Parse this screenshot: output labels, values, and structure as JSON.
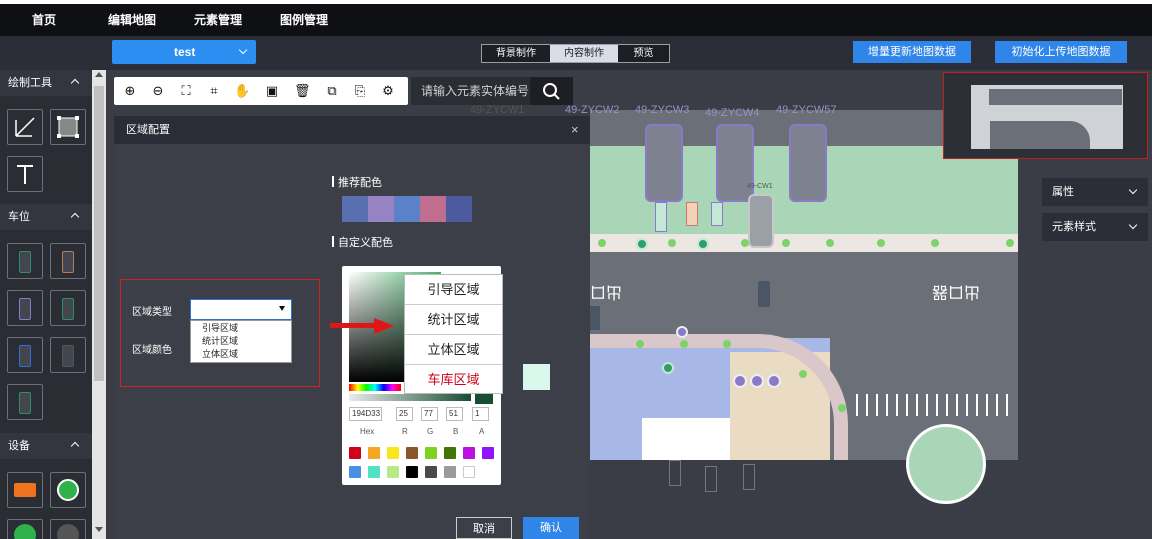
{
  "nav": {
    "items": [
      "首页",
      "编辑地图",
      "元素管理",
      "图例管理"
    ]
  },
  "project": {
    "name": "test"
  },
  "modes": [
    "背景制作",
    "内容制作",
    "预览"
  ],
  "active_mode": "内容制作",
  "top_buttons": [
    "增量更新地图数据",
    "初始化上传地图数据"
  ],
  "left": {
    "sections": [
      {
        "title": "绘制工具"
      },
      {
        "title": "车位"
      },
      {
        "title": "设备"
      }
    ],
    "draw_tools": [
      "line-tool-icon",
      "polygon-tool-icon",
      "text-tool-icon"
    ],
    "slot_colors": [
      "#2c8f6c",
      "#b87b55",
      "#8a7ac8",
      "#2c8f6c",
      "#2f6fd8",
      "#4a5a55",
      "#2c8f6c"
    ]
  },
  "map_toolbar": {
    "icons": [
      "zoom-in-icon",
      "zoom-out-icon",
      "fit-screen-icon",
      "fullscreen-icon",
      "pan-hand-icon",
      "save-icon",
      "delete-icon",
      "copy-icon",
      "paste-icon",
      "settings-icon"
    ],
    "search_placeholder": "请输入元素实体编号"
  },
  "map": {
    "lot_labels": [
      "49-ZYCW1",
      "49-ZYCW2",
      "49-ZYCW3",
      "49-ZYCW4",
      "49-ZYCW57"
    ],
    "lot_label_cw": "49-CW1",
    "road_text_1": "出口",
    "road_text_2": "出口器"
  },
  "right_panels": [
    "属性",
    "元素样式"
  ],
  "dialog": {
    "title": "区域配置",
    "close": "×",
    "recommend_title": "推荐配色",
    "recommend_colors": [
      "#5a6fb0",
      "#9583c4",
      "#5b82c9",
      "#c16d8f",
      "#4c5aa0"
    ],
    "custom_title": "自定义配色",
    "type_label": "区域类型",
    "color_label": "区域颜色",
    "type_options": [
      "引导区域",
      "统计区域",
      "立体区域"
    ],
    "cancel": "取消",
    "confirm": "确认"
  },
  "picker": {
    "hex": "194D33",
    "r": "25",
    "g": "77",
    "b": "51",
    "a": "1",
    "labels": [
      "Hex",
      "R",
      "G",
      "B",
      "A"
    ],
    "presets": [
      "#d0021b",
      "#f5a623",
      "#f8e71c",
      "#8b572a",
      "#7ed321",
      "#417505",
      "#bd10e0",
      "#9013fe",
      "#4a90e2",
      "#50e3c2",
      "#b8e986",
      "#000000",
      "#4a4a4a",
      "#9b9b9b",
      "#ffffff"
    ]
  },
  "area_dropdown": {
    "items": [
      "引导区域",
      "统计区域",
      "立体区域",
      "车库区域"
    ],
    "highlight_color": "#d0021b"
  }
}
